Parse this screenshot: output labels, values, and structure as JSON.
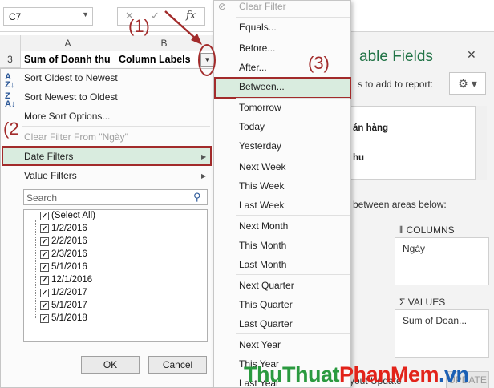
{
  "formula_bar": {
    "name_box": "C7",
    "fx": "fx"
  },
  "grid": {
    "columns": [
      "A",
      "B"
    ],
    "row_number": "3",
    "cell_a3": "Sum of Doanh thu",
    "cell_b3": "Column Labels"
  },
  "filter_menu": {
    "sort_oldest": "Sort Oldest to Newest",
    "sort_newest": "Sort Newest to Oldest",
    "more_sort": "More Sort Options...",
    "clear_filter": "Clear Filter From \"Ngày\"",
    "date_filters": "Date Filters",
    "value_filters": "Value Filters",
    "search_placeholder": "Search",
    "checklist": [
      "(Select All)",
      "1/2/2016",
      "2/2/2016",
      "2/3/2016",
      "5/1/2016",
      "12/1/2016",
      "1/2/2017",
      "5/1/2017",
      "5/1/2018"
    ],
    "ok": "OK",
    "cancel": "Cancel"
  },
  "date_submenu": {
    "items": [
      "Clear Filter",
      "Equals...",
      "Before...",
      "After...",
      "Between...",
      "Tomorrow",
      "Today",
      "Yesterday",
      "Next Week",
      "This Week",
      "Last Week",
      "Next Month",
      "This Month",
      "Last Month",
      "Next Quarter",
      "This Quarter",
      "Last Quarter",
      "Next Year",
      "This Year",
      "Last Year"
    ]
  },
  "pivot_pane": {
    "title": "able Fields",
    "subtitle": "s to add to report:",
    "field_1": "án hàng",
    "field_2": "hu",
    "drag_hint": "between areas below:",
    "columns_label": "COLUMNS",
    "columns_chip": "Ngày",
    "values_label": "VALUES",
    "values_chip": "Sum of Doan...",
    "footer": "yout Update",
    "update_button": "UPDATE"
  },
  "annotations": {
    "step1": "(1)",
    "step2": "(2",
    "step3": "(3)"
  },
  "watermark": {
    "part1": "ThuThuat",
    "part2": "PhanMem",
    "part3": ".vn"
  },
  "colors": {
    "accent_green": "#217346",
    "annotation_red": "#a22b2b",
    "highlight": "#d9ecdf"
  }
}
